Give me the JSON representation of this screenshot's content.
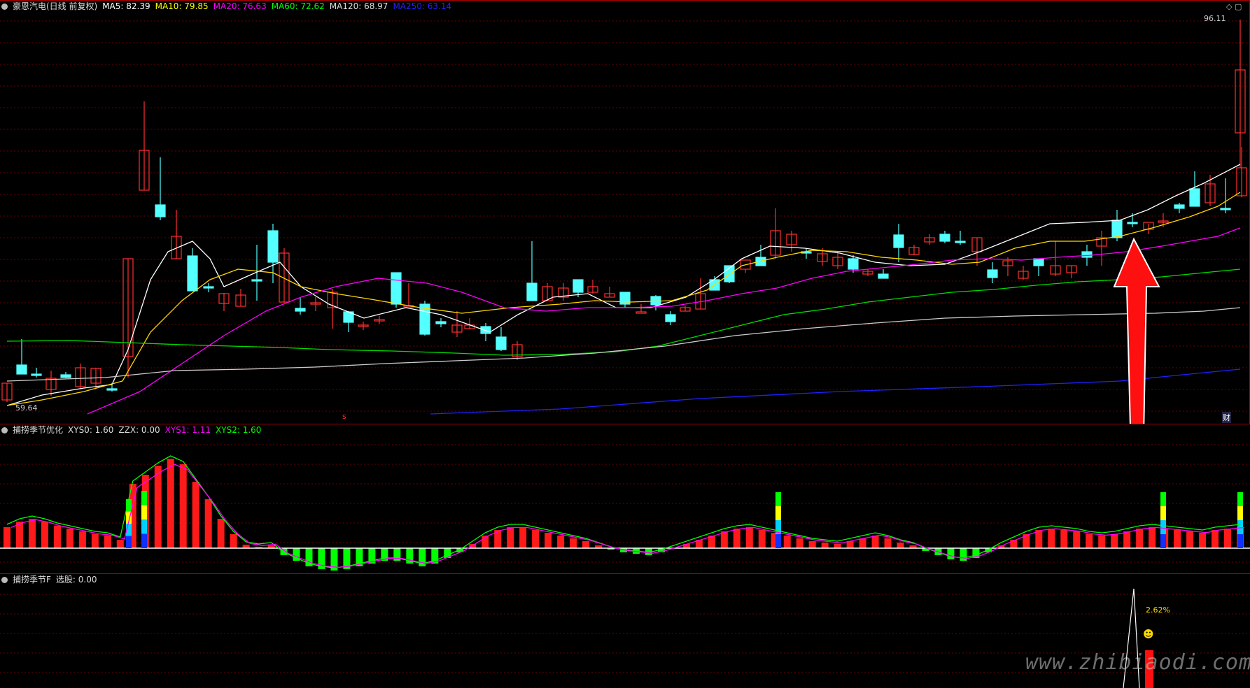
{
  "main": {
    "stock": "豪恩汽电(日线 前复权)",
    "ma_labels": [
      {
        "text": "MA5: 82.39",
        "color": "#ffffff"
      },
      {
        "text": "MA10: 79.85",
        "color": "#ffff00"
      },
      {
        "text": "MA20: 76.63",
        "color": "#ff00ff"
      },
      {
        "text": "MA60: 72.62",
        "color": "#00ff00"
      },
      {
        "text": "MA120: 68.97",
        "color": "#dddddd"
      },
      {
        "text": "MA250: 63.14",
        "color": "#2222ff"
      }
    ],
    "high_label": "96.11",
    "low_label": "59.64",
    "marker_s": "s",
    "marker_fin": "财",
    "colors": {
      "up": "#ff3030",
      "down": "#54ffff",
      "grid": "#6a0000",
      "border": "#b00000"
    }
  },
  "ind1": {
    "title": "捕捞季节优化",
    "labels": [
      {
        "text": "XYS0: 1.60",
        "color": "#dddddd"
      },
      {
        "text": "ZZX: 0.00",
        "color": "#dddddd"
      },
      {
        "text": "XYS1: 1.11",
        "color": "#ff00ff"
      },
      {
        "text": "XYS2: 1.60",
        "color": "#00ff00"
      }
    ]
  },
  "ind2": {
    "title": "捕捞季节F",
    "labels": [
      {
        "text": "选股: 0.00",
        "color": "#dddddd"
      }
    ],
    "pct": "2.62%"
  },
  "watermark": "www.zhibiaodi.com",
  "icons": [
    "toggle-circle-icon",
    "smiley-icon",
    "up-arrow-icon"
  ]
}
